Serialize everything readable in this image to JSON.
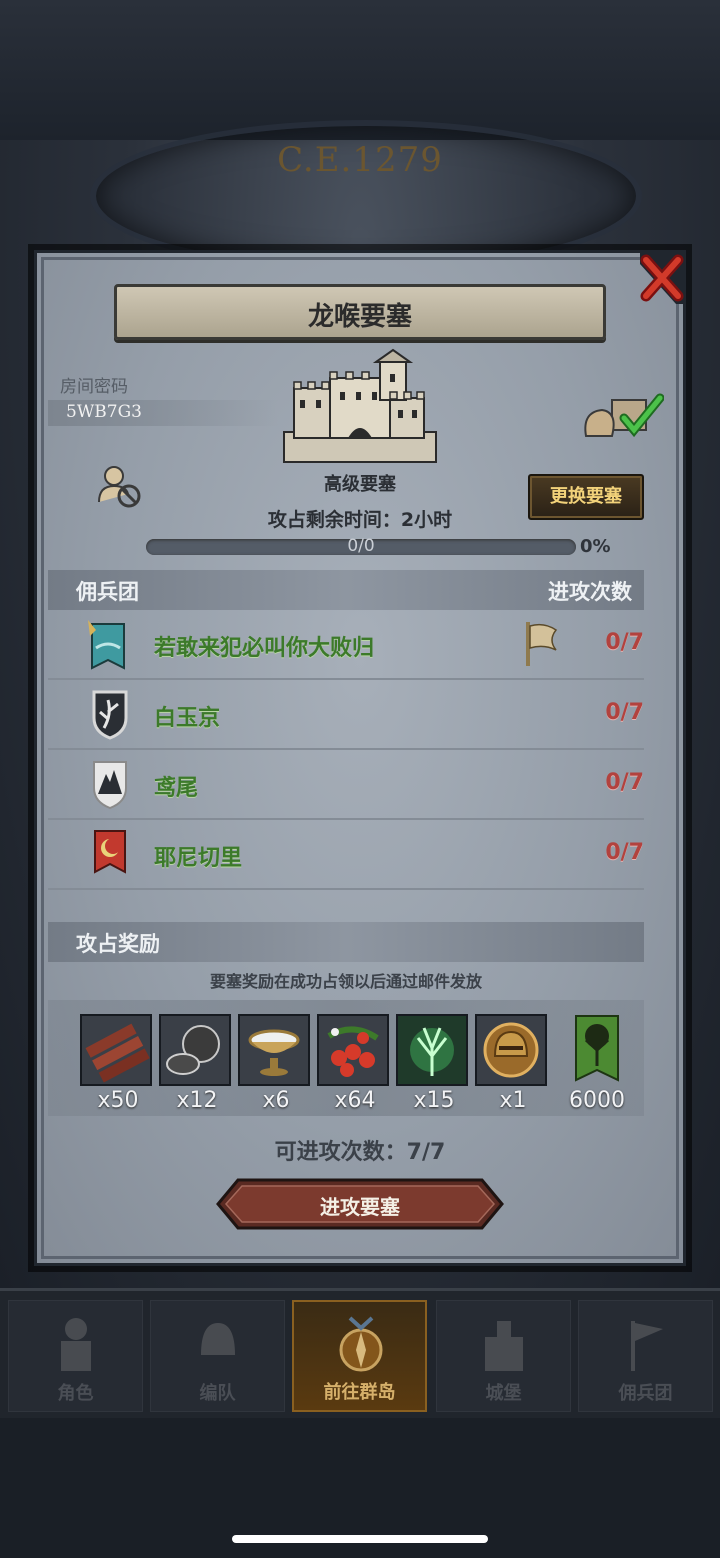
{
  "header": {
    "era": "C.E.1279"
  },
  "dialog": {
    "title": "龙喉要塞",
    "room_password_label": "房间密码",
    "room_password": "5WB7G3",
    "fortress_level": "高级要塞",
    "time_remaining": "攻占剩余时间：2小时",
    "change_button": "更换要塞",
    "progress": {
      "text": "0/0",
      "percent": "0%",
      "value": 0
    },
    "mercenary_header": "佣兵团",
    "attack_count_header": "进攻次数",
    "mercenaries": [
      {
        "name": "若敢来犯必叫你大败归",
        "count": "0/7",
        "banner": "teal-crown-banner",
        "has_flag": true
      },
      {
        "name": "白玉京",
        "count": "0/7",
        "banner": "white-tree-shield"
      },
      {
        "name": "鸢尾",
        "count": "0/7",
        "banner": "white-mountain-shield"
      },
      {
        "name": "耶尼切里",
        "count": "0/7",
        "banner": "red-crescent-banner"
      }
    ],
    "rewards_header": "攻占奖励",
    "rewards_note": "要塞奖励在成功占领以后通过邮件发放",
    "rewards": [
      {
        "item": "wood-logs-icon",
        "qty": "x50"
      },
      {
        "item": "stone-ore-icon",
        "qty": "x12"
      },
      {
        "item": "silver-bowl-icon",
        "qty": "x6"
      },
      {
        "item": "berries-icon",
        "qty": "x64"
      },
      {
        "item": "green-crystal-icon",
        "qty": "x15"
      },
      {
        "item": "golden-helmet-icon",
        "qty": "x1"
      },
      {
        "item": "green-tree-banner-icon",
        "qty": "6000"
      }
    ],
    "attempts": "可进攻次数：7/7",
    "attack_button": "进攻要塞"
  },
  "nav": {
    "items": [
      {
        "label": "角色",
        "active": false
      },
      {
        "label": "编队",
        "active": false
      },
      {
        "label": "前往群岛",
        "active": true
      },
      {
        "label": "城堡",
        "active": false
      },
      {
        "label": "佣兵团",
        "active": false
      }
    ]
  },
  "colors": {
    "mercenary_name": "#3c7a2a",
    "attack_count": "#b2423e",
    "change_button_text": "#f2d27a"
  }
}
